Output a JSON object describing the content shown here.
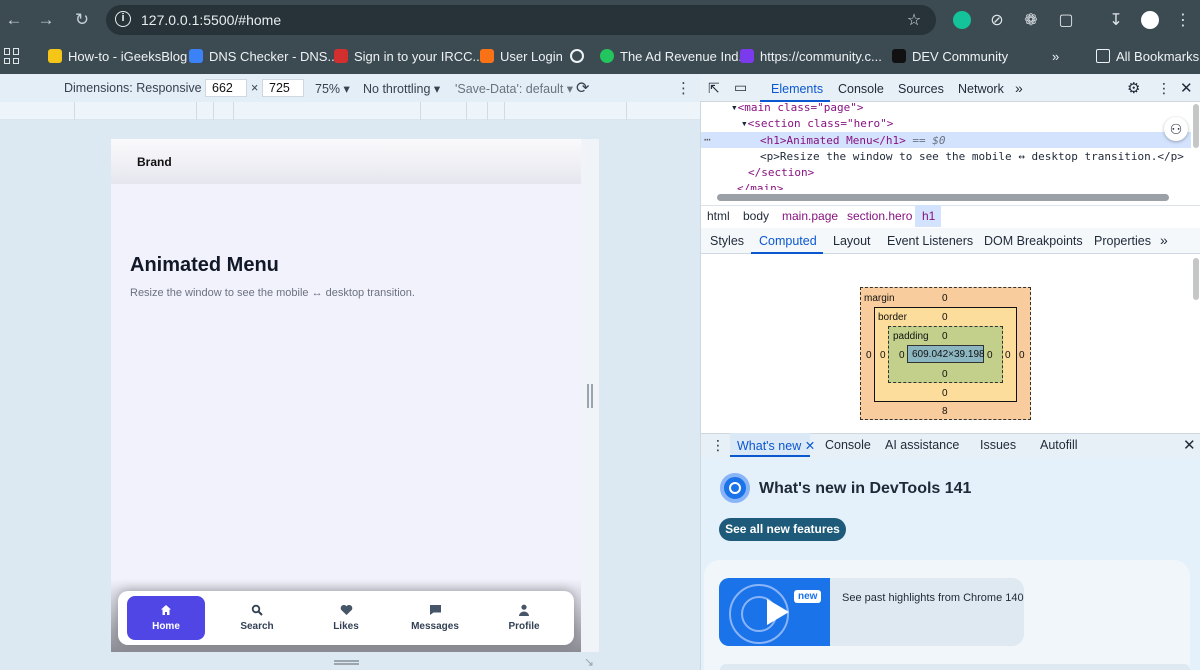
{
  "browser": {
    "url": "127.0.0.1:5500/#home",
    "bookmarks": [
      {
        "label": "How-to - iGeeksBlog",
        "color": "#f5c518"
      },
      {
        "label": "DNS Checker - DNS...",
        "color": "#3b82f6"
      },
      {
        "label": "Sign in to your IRCC...",
        "color": "#d32f2f"
      },
      {
        "label": "User Login",
        "color": "#f97316"
      },
      {
        "label": "The Ad Revenue Ind...",
        "color": "#22c55e"
      },
      {
        "label": "https://community.c...",
        "color": "#7c3aed"
      },
      {
        "label": "DEV Community",
        "color": "#111111"
      }
    ],
    "more_bookmarks": "»",
    "all_bookmarks": "All Bookmarks"
  },
  "device_toolbar": {
    "dimensions_label": "Dimensions: Responsive",
    "width": "662",
    "times": "×",
    "height": "725",
    "zoom": "75%",
    "throttling": "No throttling",
    "save_data": "'Save-Data': default"
  },
  "app": {
    "brand": "Brand",
    "title": "Animated Menu",
    "subtitle": "Resize the window to see the mobile ↔ desktop transition.",
    "nav": [
      {
        "label": "Home",
        "icon": "home-icon",
        "active": true
      },
      {
        "label": "Search",
        "icon": "search-icon",
        "active": false
      },
      {
        "label": "Likes",
        "icon": "heart-icon",
        "active": false
      },
      {
        "label": "Messages",
        "icon": "message-icon",
        "active": false
      },
      {
        "label": "Profile",
        "icon": "user-icon",
        "active": false
      }
    ],
    "accent": "#4f46e5"
  },
  "devtools": {
    "tabs": [
      "Elements",
      "Console",
      "Sources",
      "Network"
    ],
    "active_tab": "Elements",
    "dom": {
      "main_open": "<main class=\"page\">",
      "section_open": "<section class=\"hero\">",
      "h1_line": "<h1>Animated Menu</h1>",
      "h1_marker": "== $0",
      "p_line": "<p>Resize the window to see the mobile ↔ desktop transition.</p>",
      "section_close": "</section>",
      "main_close": "</main>"
    },
    "breadcrumbs": [
      "html",
      "body",
      "main.page",
      "section.hero",
      "h1"
    ],
    "subtabs": [
      "Styles",
      "Computed",
      "Layout",
      "Event Listeners",
      "DOM Breakpoints",
      "Properties"
    ],
    "active_subtab": "Computed",
    "box_model": {
      "margin_label": "margin",
      "border_label": "border",
      "padding_label": "padding",
      "margin": {
        "top": "0",
        "right": "0",
        "bottom": "8",
        "left": "0"
      },
      "border": {
        "top": "0",
        "right": "0",
        "bottom": "0",
        "left": "0"
      },
      "padding": {
        "top": "0",
        "right": "0",
        "bottom": "0",
        "left": "0"
      },
      "content": "609.042×39.198"
    },
    "drawer_tabs": [
      "What's new",
      "Console",
      "AI assistance",
      "Issues",
      "Autofill"
    ],
    "whats_new": {
      "title": "What's new in DevTools 141",
      "button": "See all new features",
      "badge": "new",
      "highlight": "See past highlights from Chrome 140"
    }
  }
}
